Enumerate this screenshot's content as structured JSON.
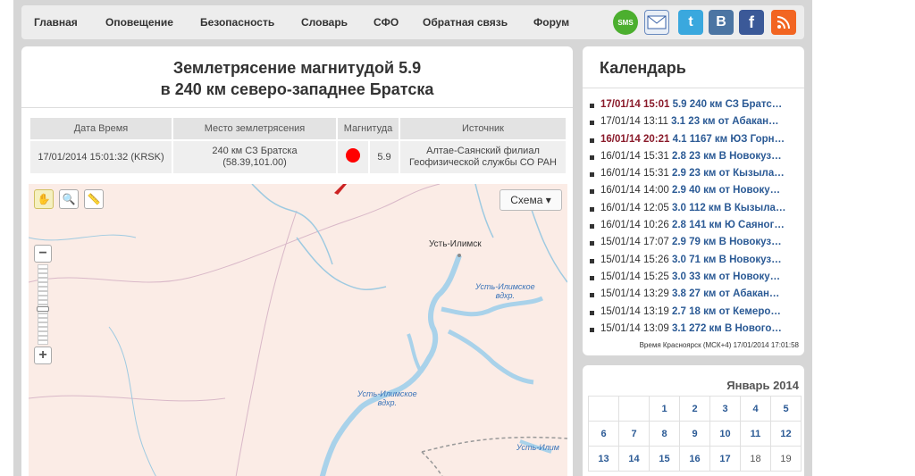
{
  "nav": {
    "items": [
      "Главная",
      "Оповещение",
      "Безопасность",
      "Словарь",
      "СФО",
      "Обратная связь",
      "Форум"
    ],
    "social": [
      "sms-icon",
      "mail-icon",
      "twitter-icon",
      "vk-icon",
      "facebook-icon",
      "rss-icon"
    ],
    "sms_label": "SMS"
  },
  "quake": {
    "title_line1": "Землетрясение магнитудой 5.9",
    "title_line2": "в 240 км северо-западнее Братска",
    "headers": [
      "Дата Время",
      "Место землетрясения",
      "Магнитуда",
      "Источник"
    ],
    "datetime": "17/01/2014 15:01:32 (KRSK)",
    "place_line1": "240 км СЗ Братска",
    "place_line2": "(58.39,101.00)",
    "magnitude": "5.9",
    "source_line1": "Алтае-Саянский филиал",
    "source_line2": "Геофизической службы СО РАН",
    "marker_color": "#ff0000"
  },
  "map": {
    "scheme_label": "Схема ▾",
    "labels": {
      "city": "Усть-Илимск",
      "res1_line1": "Усть-Илимское",
      "res1_line2": "вдхр.",
      "res2_line1": "Усть-Илимское",
      "res2_line2": "вдхр.",
      "res3": "Усть-Илим"
    },
    "zoom_plus": "+",
    "zoom_minus": "−",
    "tools": [
      "hand-icon",
      "magnifier-icon",
      "ruler-icon"
    ]
  },
  "calendar": {
    "title": "Календарь",
    "events": [
      {
        "date": "17/01/14 15:01",
        "highlight": true,
        "mag": "5.9",
        "text": "240 км СЗ Братс…"
      },
      {
        "date": "17/01/14 13:11",
        "highlight": false,
        "mag": "3.1",
        "text": "23 км от Абакан…"
      },
      {
        "date": "16/01/14 20:21",
        "highlight": true,
        "mag": "4.1",
        "text": "1167 км ЮЗ Горн…"
      },
      {
        "date": "16/01/14 15:31",
        "highlight": false,
        "mag": "2.8",
        "text": "23 км В Новокуз…"
      },
      {
        "date": "16/01/14 15:31",
        "highlight": false,
        "mag": "2.9",
        "text": "23 км от Кызыла…"
      },
      {
        "date": "16/01/14 14:00",
        "highlight": false,
        "mag": "2.9",
        "text": "40 км от Новоку…"
      },
      {
        "date": "16/01/14 12:05",
        "highlight": false,
        "mag": "3.0",
        "text": "112 км В Кызыла…"
      },
      {
        "date": "16/01/14 10:26",
        "highlight": false,
        "mag": "2.8",
        "text": "141 км Ю Саяног…"
      },
      {
        "date": "15/01/14 17:07",
        "highlight": false,
        "mag": "2.9",
        "text": "79 км В Новокуз…"
      },
      {
        "date": "15/01/14 15:26",
        "highlight": false,
        "mag": "3.0",
        "text": "71 км В Новокуз…"
      },
      {
        "date": "15/01/14 15:25",
        "highlight": false,
        "mag": "3.0",
        "text": "33 км от Новоку…"
      },
      {
        "date": "15/01/14 13:29",
        "highlight": false,
        "mag": "3.8",
        "text": "27 км от Абакан…"
      },
      {
        "date": "15/01/14 13:19",
        "highlight": false,
        "mag": "2.7",
        "text": "18 км от Кемеро…"
      },
      {
        "date": "15/01/14 13:09",
        "highlight": false,
        "mag": "3.1",
        "text": "272 км В Нового…"
      }
    ],
    "time_note": "Время Красноярск (МСК+4) 17/01/2014 17:01:58"
  },
  "month": {
    "title": "Январь 2014",
    "rows": [
      [
        {
          "d": "",
          "link": false
        },
        {
          "d": "",
          "link": false
        },
        {
          "d": "1",
          "link": true
        },
        {
          "d": "2",
          "link": true
        },
        {
          "d": "3",
          "link": true
        },
        {
          "d": "4",
          "link": true
        },
        {
          "d": "5",
          "link": true
        }
      ],
      [
        {
          "d": "6",
          "link": true
        },
        {
          "d": "7",
          "link": true
        },
        {
          "d": "8",
          "link": true
        },
        {
          "d": "9",
          "link": true
        },
        {
          "d": "10",
          "link": true
        },
        {
          "d": "11",
          "link": true
        },
        {
          "d": "12",
          "link": true
        }
      ],
      [
        {
          "d": "13",
          "link": true
        },
        {
          "d": "14",
          "link": true
        },
        {
          "d": "15",
          "link": true
        },
        {
          "d": "16",
          "link": true
        },
        {
          "d": "17",
          "link": true
        },
        {
          "d": "18",
          "link": false
        },
        {
          "d": "19",
          "link": false
        }
      ]
    ]
  }
}
